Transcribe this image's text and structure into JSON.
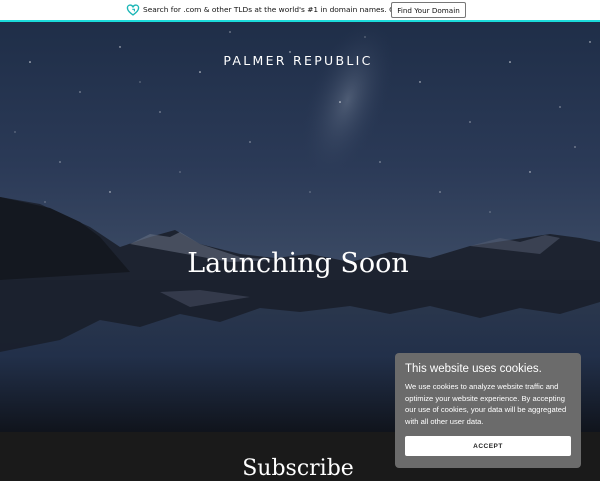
{
  "topbar": {
    "logo_icon": "godaddy-heart-icon",
    "promo_text": "Search for .com & other TLDs at the world's #1 in domain names. Get online today!",
    "cta_label": "Find Your Domain",
    "accent_color": "#1bdbdb"
  },
  "hero": {
    "brand": "PALMER REPUBLIC",
    "headline": "Launching Soon"
  },
  "subscribe": {
    "title": "Subscribe"
  },
  "cookie_banner": {
    "title": "This website uses cookies.",
    "body": "We use cookies to analyze website traffic and optimize your website experience. By accepting our use of cookies, your data will be aggregated with all other user data.",
    "accept_label": "ACCEPT"
  }
}
